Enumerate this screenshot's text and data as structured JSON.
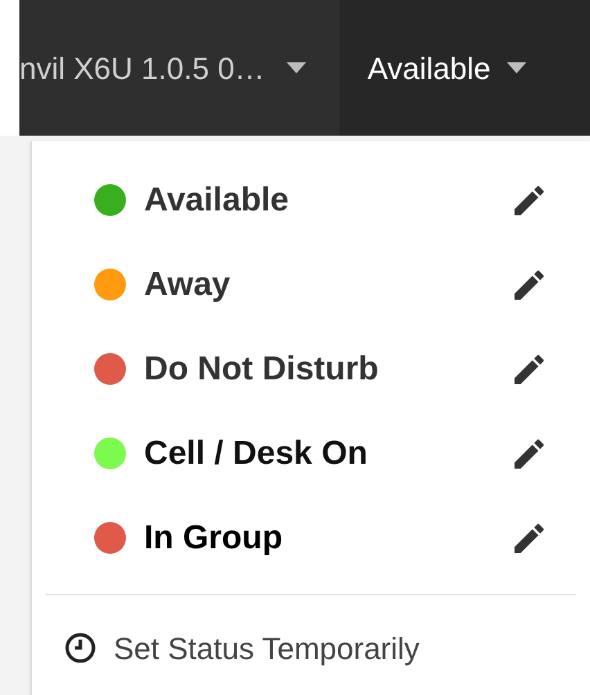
{
  "top_bar": {
    "device": "nvil X6U 1.0.5 0…",
    "status": "Available"
  },
  "status_menu": {
    "items": [
      {
        "label": "Available",
        "color": "#3aaf1e"
      },
      {
        "label": "Away",
        "color": "#ff9a0e"
      },
      {
        "label": "Do Not Disturb",
        "color": "#e05a4a"
      },
      {
        "label": "Cell / Desk On",
        "color": "#7dfa4f"
      },
      {
        "label": "In Group",
        "color": "#e05a4a"
      }
    ],
    "footer": "Set Status Temporarily"
  }
}
